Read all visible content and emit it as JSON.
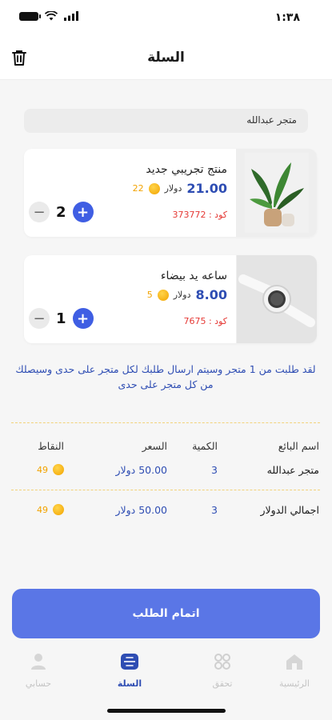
{
  "status_bar": {
    "time": "١:٣٨"
  },
  "header": {
    "title": "السلة"
  },
  "store_name": "متجر عبدالله",
  "cart_items": [
    {
      "name": "منتج تجريبي جديد",
      "price": "21.00",
      "currency": "دولار",
      "points": "22",
      "code": "كود : 373772",
      "quantity": "2"
    },
    {
      "name": "ساعه يد بيضاء",
      "price": "8.00",
      "currency": "دولار",
      "points": "5",
      "code": "كود : 7675",
      "quantity": "1"
    }
  ],
  "notice": "لقد طلبت من 1 متجر وسيتم ارسال طلبك لكل متجر على حدى وسيصلك من كل متجر على حدى",
  "summary": {
    "headers": {
      "seller": "اسم البائع",
      "qty": "الكمية",
      "price": "السعر",
      "points": "النقاط"
    },
    "row": {
      "seller": "متجر عبدالله",
      "qty": "3",
      "price": "50.00 دولار",
      "points": "49"
    },
    "total": {
      "label": "اجمالي الدولار",
      "qty": "3",
      "price": "50.00 دولار",
      "points": "49"
    }
  },
  "checkout_label": "اتمام الطلب",
  "tabs": {
    "home": "الرئيسية",
    "verify": "تحقق",
    "cart": "السلة",
    "account": "حسابي"
  },
  "colors": {
    "accent": "#3f5ee3",
    "button": "#5a76e6",
    "price": "#2e4db3",
    "code": "#e53935",
    "points": "#f2a300"
  }
}
